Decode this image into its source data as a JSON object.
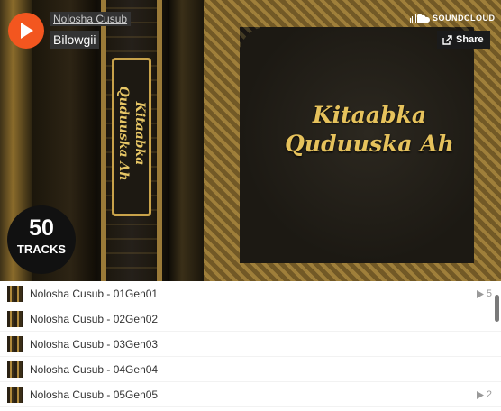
{
  "header": {
    "user_name": "Nolosha Cusub",
    "playlist_title": "Bilowgii",
    "brand": "SOUNDCLOUD",
    "share_label": "Share"
  },
  "artwork": {
    "cover_title_line1": "Kitaabka",
    "cover_title_line2": "Quduuska Ah",
    "spine_line1": "Kitaabka",
    "spine_line2": "Quduuska Ah"
  },
  "track_count": {
    "number": "50",
    "label": "TRACKS"
  },
  "tracks": [
    {
      "title": "Nolosha Cusub - 01Gen01",
      "plays": "5"
    },
    {
      "title": "Nolosha Cusub - 02Gen02",
      "plays": ""
    },
    {
      "title": "Nolosha Cusub - 03Gen03",
      "plays": ""
    },
    {
      "title": "Nolosha Cusub - 04Gen04",
      "plays": ""
    },
    {
      "title": "Nolosha Cusub - 05Gen05",
      "plays": "2"
    }
  ],
  "colors": {
    "accent": "#f3561f",
    "gold": "#e6c25c"
  },
  "icons": {
    "play": "play-icon",
    "soundcloud": "soundcloud-cloud-icon",
    "share": "share-icon",
    "play_count": "play-count-icon"
  }
}
